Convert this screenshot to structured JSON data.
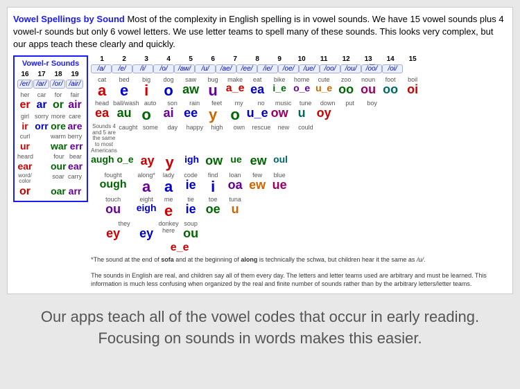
{
  "title": {
    "bold": "Vowel Spellings by Sound",
    "text": " Most of the complexity in English spelling is in vowel sounds. We have 15 vowel sounds plus 4 vowel-r sounds but only 6 vowel letters. We use letter teams to spell many of these sounds. This looks very complex, but our apps teach these clearly and quickly."
  },
  "tagline": "Our apps teach all of the vowel codes that occur in early reading. Focusing on sounds in words makes this easier.",
  "vowelr": {
    "title": "Vowel-r Sounds",
    "nums": [
      "16",
      "17",
      "18",
      "19"
    ],
    "labels": [
      "/er/",
      "/ar/",
      "/or/",
      "/air/"
    ],
    "rows": [
      [
        "her",
        "car",
        "for",
        "fair"
      ],
      [
        "er",
        "ar",
        "or",
        "air"
      ],
      [
        "girl",
        "sorry",
        "more",
        "care"
      ],
      [
        "ir",
        "orr",
        "ore",
        "are"
      ],
      [
        "curl",
        "",
        "warm",
        "berry"
      ],
      [
        "ur",
        "",
        "war",
        "err"
      ],
      [
        "heard",
        "",
        "four",
        "bear"
      ],
      [
        "ear",
        "",
        "our",
        "ear"
      ],
      [
        "word/color",
        "",
        "soar",
        "carry"
      ],
      [
        "or",
        "",
        "oar",
        "arr"
      ]
    ]
  },
  "bottom_note": {
    "star_text": "*The sound at the end of sofa and at the beginning of along is technically the schwa, but children hear it the same as /u/.",
    "sounds_text": "The sounds in English are real, and children say all of them every day. The letters and letter teams used are arbitrary and must be learned. This information is much less confusing when organized by the real and finite number of sounds rather than by the arbitrary letters/letter teams."
  }
}
